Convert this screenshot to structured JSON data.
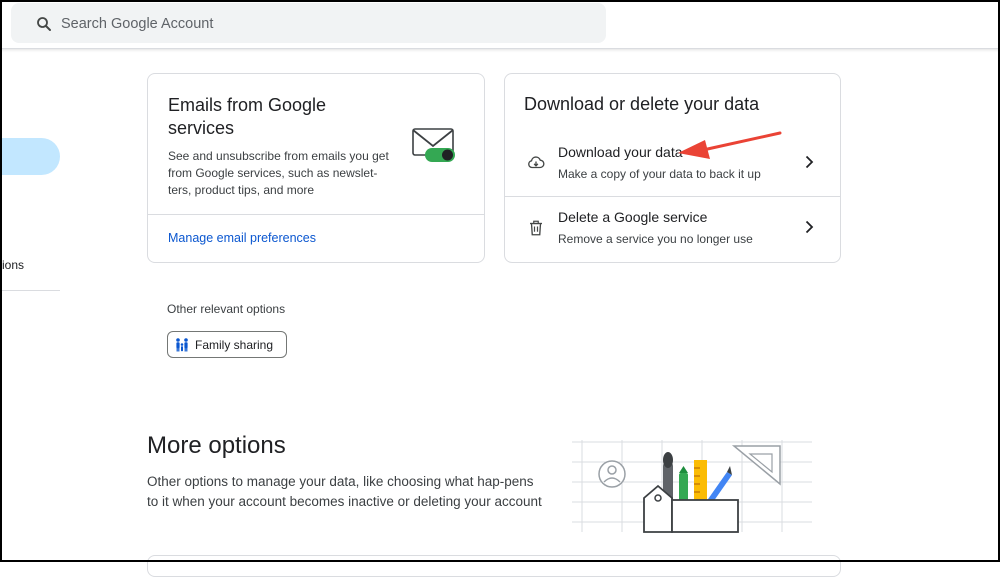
{
  "header": {
    "search_placeholder": "Search Google Account"
  },
  "sidebar": {
    "partial_item_label": "ions"
  },
  "emails_card": {
    "title": "Emails from Google services",
    "description": "See and unsubscribe from emails you get from Google services, such as newslet-ters, product tips, and more",
    "link_label": "Manage email preferences",
    "illustration_icon": "envelope-toggle-icon",
    "toggle_color": "#34a853"
  },
  "download_card": {
    "title": "Download or delete your data",
    "rows": [
      {
        "title": "Download your data",
        "subtitle": "Make a copy of your data to back it up",
        "icon": "cloud-download-icon"
      },
      {
        "title": "Delete a Google service",
        "subtitle": "Remove a service you no longer use",
        "icon": "trash-icon"
      }
    ]
  },
  "other_options": {
    "label": "Other relevant options",
    "chips": [
      {
        "label": "Family sharing",
        "icon": "family-icon"
      }
    ]
  },
  "more_options": {
    "title": "More options",
    "description": "Other options to manage your data, like choosing what hap-pens to it when your account becomes inactive or deleting your account"
  },
  "colors": {
    "accent": "#0b57d0",
    "nav_active": "#c2e7ff",
    "annotation_arrow": "#ea4335"
  }
}
